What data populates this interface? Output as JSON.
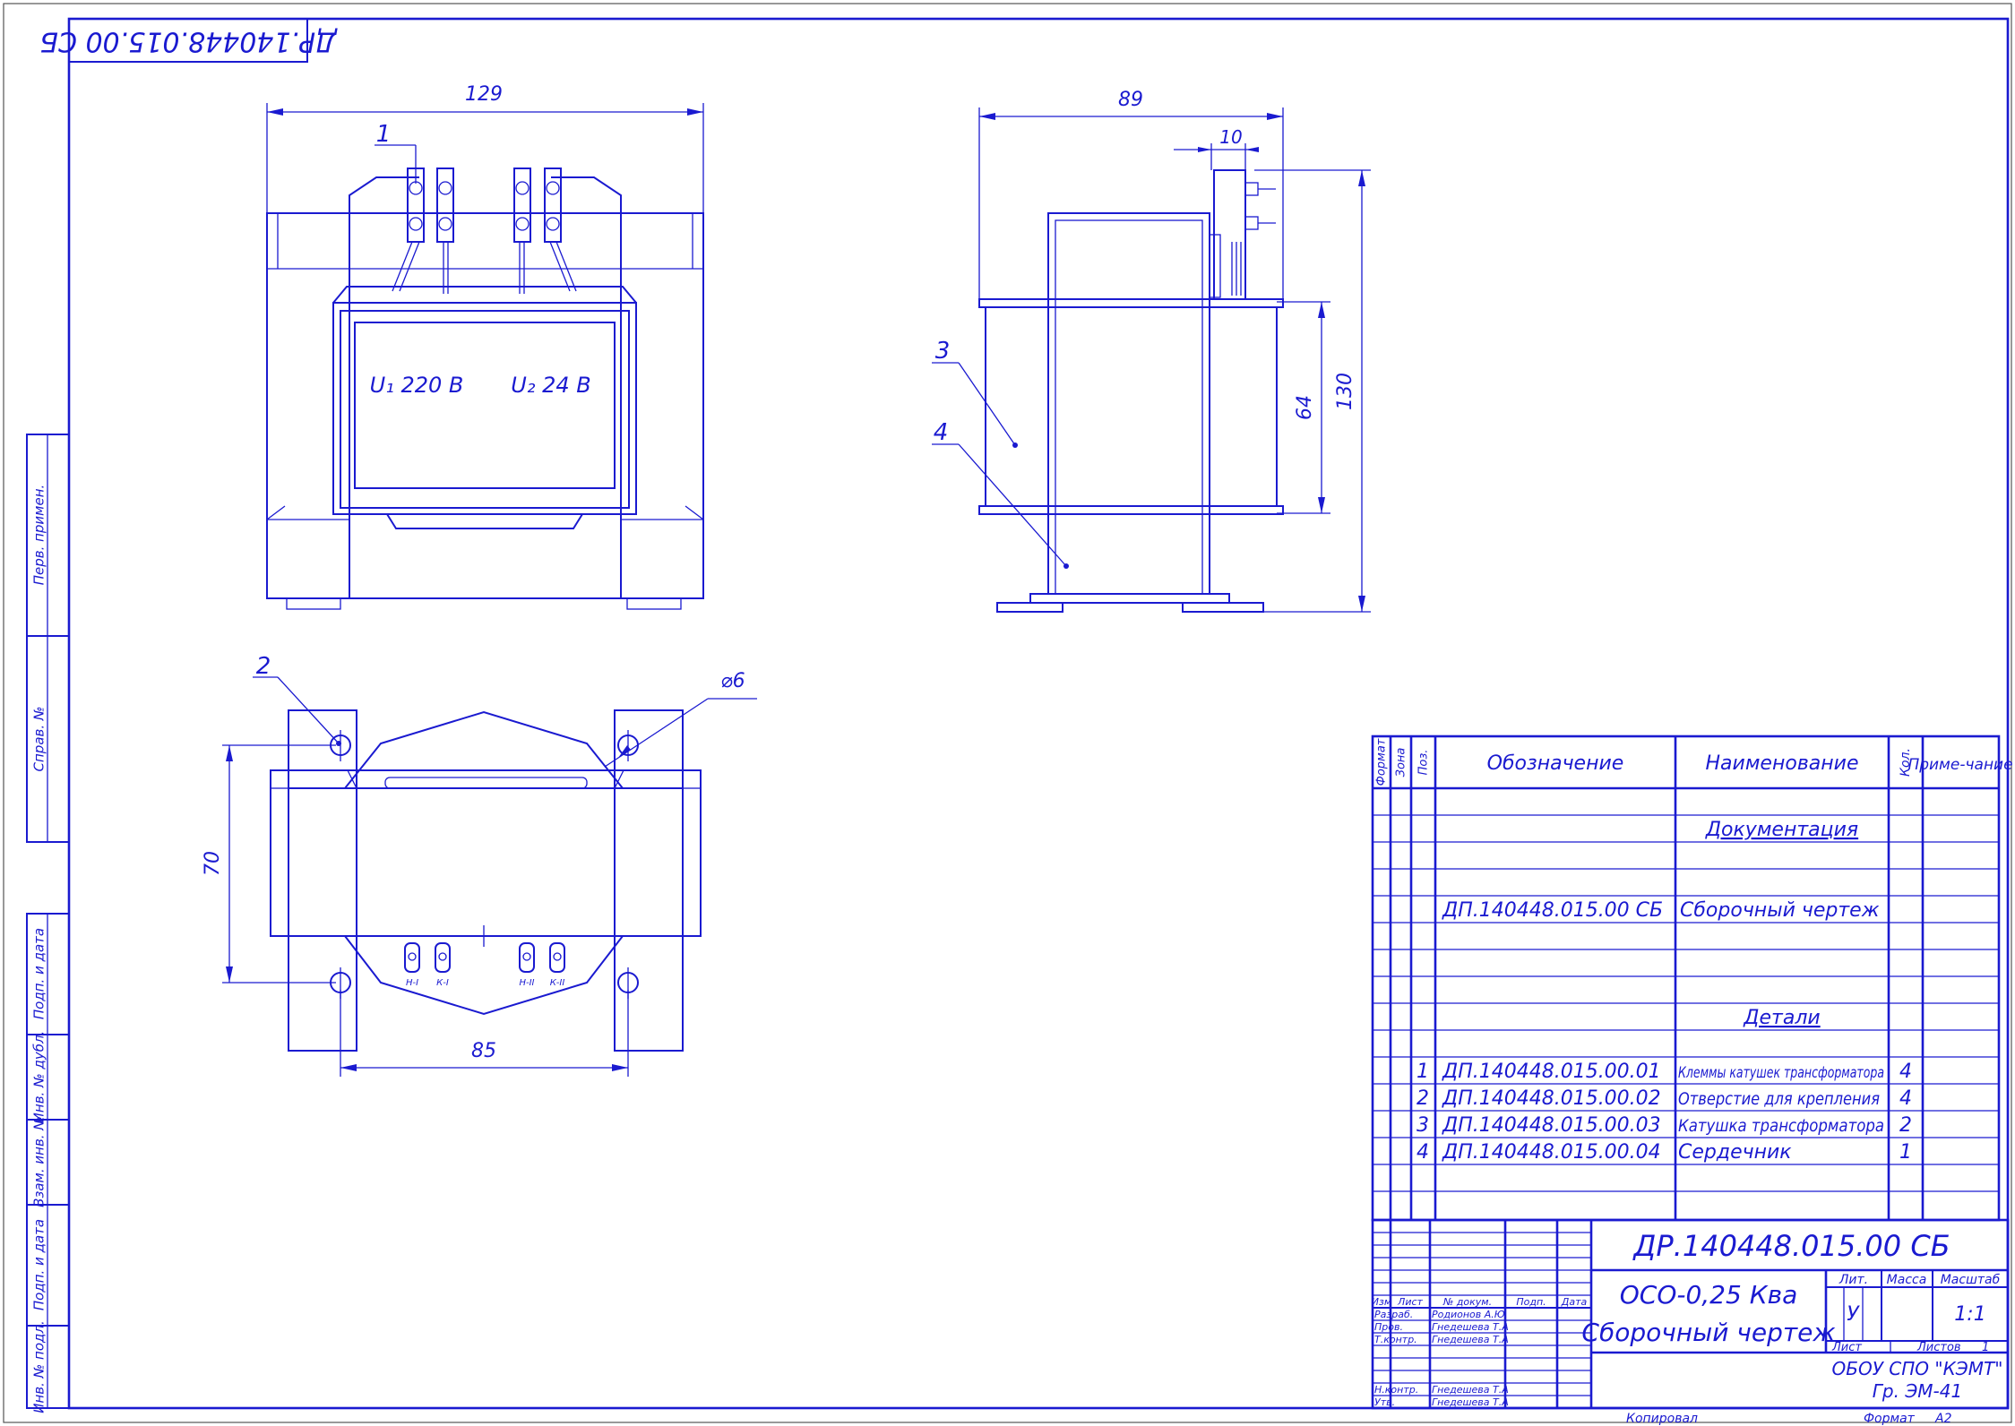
{
  "drawing": {
    "corner_stamp": "ДР.140448.015.00 СБ",
    "views": {
      "front": {
        "width_dim": "129",
        "u1_label": "U₁ 220 В",
        "u2_label": "U₂ 24 В"
      },
      "side": {
        "depth_dim": "89",
        "terminal_dim": "10",
        "height_dim": "130",
        "coil_dim": "64"
      },
      "top": {
        "hole_diameter": "⌀6",
        "hole_spacing_y": "70",
        "hole_spacing_x": "85",
        "terminal_labels": [
          "Н-I",
          "К-I",
          "Н-II",
          "К-II"
        ]
      }
    },
    "callouts": [
      "1",
      "2",
      "3",
      "4"
    ]
  },
  "left_strip": {
    "labels": [
      "Перв. примен.",
      "Справ. №",
      "Подп. и дата",
      "Инв. № дубл.",
      "Взам. инв. №",
      "Подп. и дата",
      "Инв. № подл."
    ]
  },
  "spec": {
    "headers": {
      "format": "Формат",
      "zone": "Зона",
      "pos": "Поз.",
      "designation": "Обозначение",
      "name": "Наименование",
      "qty": "Кол.",
      "note": "Приме-чание"
    },
    "sections": {
      "documentation": "Документация",
      "details": "Детали"
    },
    "doc_row": {
      "designation": "ДП.140448.015.00 СБ",
      "name": "Сборочный чертеж"
    },
    "detail_rows": [
      {
        "pos": "1",
        "designation": "ДП.140448.015.00.01",
        "name": "Клеммы катушек трансформатора",
        "qty": "4"
      },
      {
        "pos": "2",
        "designation": "ДП.140448.015.00.02",
        "name": "Отверстие для крепления",
        "qty": "4"
      },
      {
        "pos": "3",
        "designation": "ДП.140448.015.00.03",
        "name": "Катушка трансформатора",
        "qty": "2"
      },
      {
        "pos": "4",
        "designation": "ДП.140448.015.00.04",
        "name": "Сердечник",
        "qty": "1"
      }
    ]
  },
  "title_block": {
    "doc_code": "ДР.140448.015.00 СБ",
    "product_line1": "ОСО-0,25 Ква",
    "product_line2": "Сборочный чертеж",
    "col_izm": "Изм",
    "col_list": "Лист",
    "col_ndoc": "№ докум.",
    "col_podp": "Подп.",
    "col_data": "Дата",
    "rows": [
      {
        "role": "Разраб.",
        "person": "Родионов А.Ю"
      },
      {
        "role": "Пров.",
        "person": "Гнедешева Т.А"
      },
      {
        "role": "Т.контр.",
        "person": "Гнедешева Т.А"
      },
      {
        "role": "",
        "person": ""
      },
      {
        "role": "Н.контр.",
        "person": "Гнедешева Т.А"
      },
      {
        "role": "Утв.",
        "person": "Гнедешева Т.А"
      }
    ],
    "lit_label": "Лит.",
    "lit_value": "У",
    "mass_label": "Масса",
    "scale_label": "Масштаб",
    "scale_value": "1:1",
    "sheet_label": "Лист",
    "sheets_label": "Листов",
    "sheets_value": "1",
    "org_line1": "ОБОУ СПО \"КЭМТ\"",
    "org_line2": "Гр. ЭМ-41",
    "copied_label": "Копировал",
    "format_label": "Формат",
    "format_value": "А2"
  }
}
